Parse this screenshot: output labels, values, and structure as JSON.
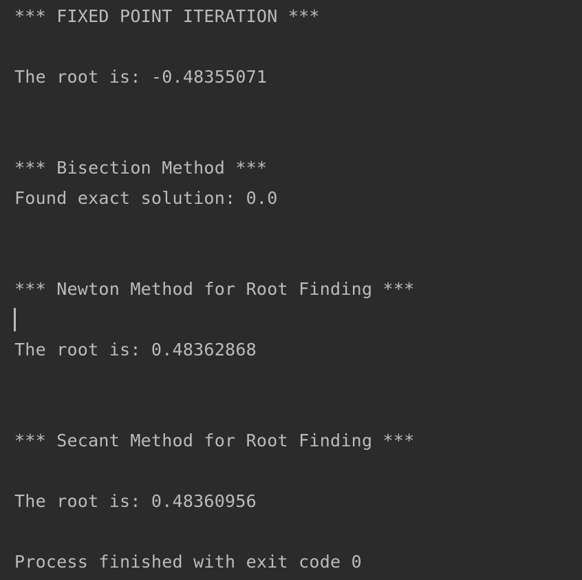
{
  "console": {
    "lines": [
      "*** FIXED POINT ITERATION ***",
      "The root is: -0.48355071",
      "*** Bisection Method ***",
      "Found exact solution: 0.0",
      "*** Newton Method for Root Finding ***",
      "The root is: 0.48362868",
      "*** Secant Method for Root Finding ***",
      "The root is: 0.48360956",
      "Process finished with exit code 0"
    ]
  },
  "colors": {
    "background": "#2b2b2b",
    "text": "#bbbbbb"
  }
}
